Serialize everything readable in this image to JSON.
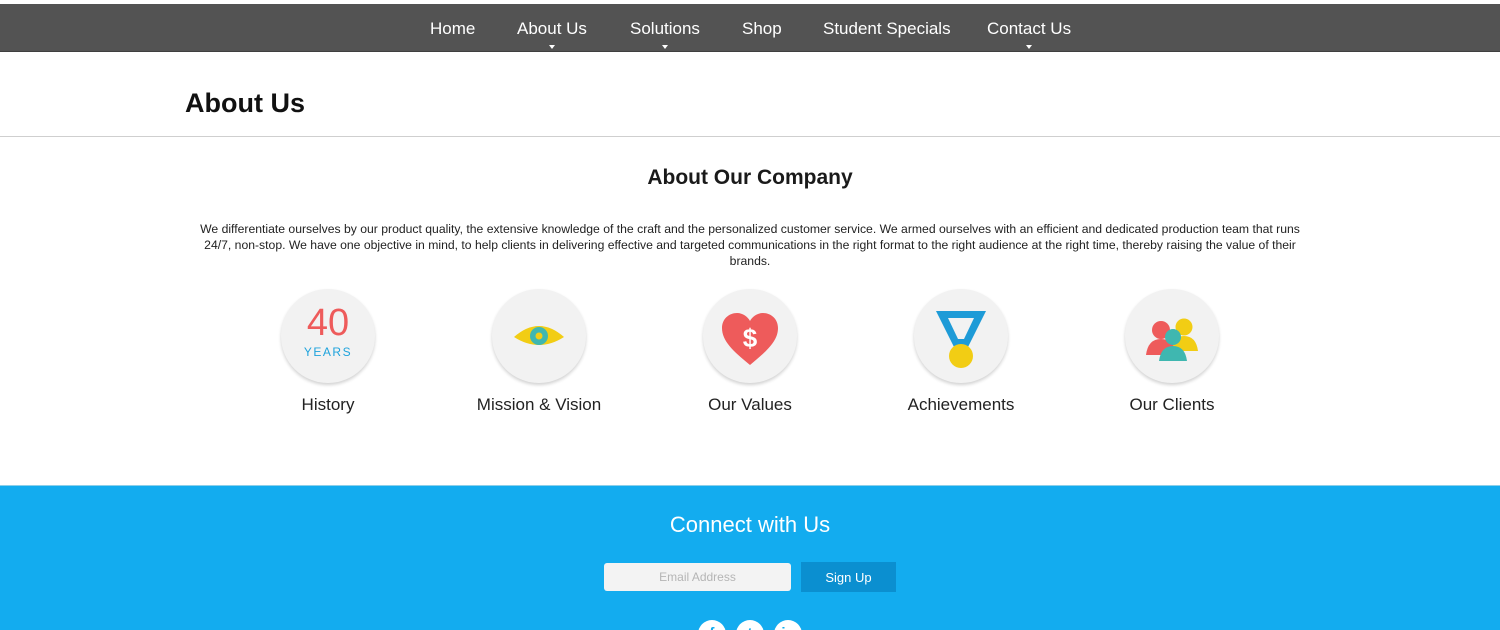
{
  "nav": {
    "items": [
      {
        "label": "Home",
        "dropdown": false
      },
      {
        "label": "About Us",
        "dropdown": true
      },
      {
        "label": "Solutions",
        "dropdown": true
      },
      {
        "label": "Shop",
        "dropdown": false
      },
      {
        "label": "Student Specials",
        "dropdown": false
      },
      {
        "label": "Contact Us",
        "dropdown": true
      }
    ]
  },
  "page": {
    "title": "About Us"
  },
  "about": {
    "heading": "About Our Company",
    "intro": "We differentiate ourselves by our product quality, the extensive knowledge of the craft and the personalized customer service. We armed ourselves with an efficient and dedicated production team that runs 24/7, non-stop. We have one objective in mind, to help clients in delivering effective and targeted communications in the right format to the right audience at the right time, thereby raising the value of their brands."
  },
  "features": [
    {
      "label": "History",
      "icon": "history-40-years-icon",
      "years_number": "40",
      "years_word": "YEARS"
    },
    {
      "label": "Mission & Vision",
      "icon": "eye-icon"
    },
    {
      "label": "Our Values",
      "icon": "heart-dollar-icon"
    },
    {
      "label": "Achievements",
      "icon": "medal-icon"
    },
    {
      "label": "Our Clients",
      "icon": "users-icon"
    }
  ],
  "footer": {
    "heading": "Connect with Us",
    "email_placeholder": "Email Address",
    "signup_label": "Sign Up",
    "social": [
      "facebook-icon",
      "twitter-icon",
      "linkedin-icon"
    ]
  },
  "colors": {
    "nav_bg": "#535353",
    "footer_bg": "#13acef",
    "button_bg": "#0b8fd0",
    "accent_red": "#ee5b5b",
    "accent_blue": "#1fa3dc",
    "accent_yellow": "#f2cd14",
    "accent_teal": "#3fb7b0"
  }
}
